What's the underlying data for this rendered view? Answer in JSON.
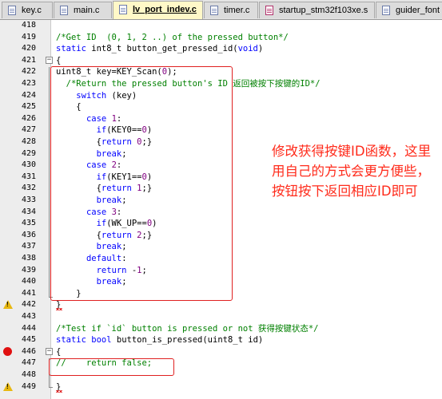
{
  "tabs": [
    {
      "label": "key.c",
      "active": false
    },
    {
      "label": "main.c",
      "active": false
    },
    {
      "label": "lv_port_indev.c",
      "active": true
    },
    {
      "label": "timer.c",
      "active": false
    },
    {
      "label": "startup_stm32f103xe.s",
      "active": false
    },
    {
      "label": "guider_font",
      "active": false
    }
  ],
  "editor": {
    "lines": [
      {
        "num": "418",
        "parts": [],
        "marker": ""
      },
      {
        "num": "419",
        "parts": [
          {
            "t": "/*Get ID  (0, 1, 2 ..) of the pressed button*/",
            "c": "cm"
          }
        ],
        "marker": ""
      },
      {
        "num": "420",
        "parts": [
          {
            "t": "static ",
            "c": "kw"
          },
          {
            "t": "int8_t button_get_pressed_id(",
            "c": ""
          },
          {
            "t": "void",
            "c": "kw"
          },
          {
            "t": ")",
            "c": ""
          }
        ],
        "marker": ""
      },
      {
        "num": "421",
        "parts": [
          {
            "t": "{",
            "c": ""
          }
        ],
        "marker": ""
      },
      {
        "num": "422",
        "parts": [
          {
            "t": "uint8_t key=KEY_Scan(",
            "c": ""
          },
          {
            "t": "0",
            "c": "num"
          },
          {
            "t": ");",
            "c": ""
          }
        ],
        "marker": ""
      },
      {
        "num": "423",
        "parts": [
          {
            "t": "  /*Return the pressed button's ID 返回被按下按键的ID*/",
            "c": "cm"
          }
        ],
        "marker": ""
      },
      {
        "num": "424",
        "parts": [
          {
            "t": "    ",
            "c": ""
          },
          {
            "t": "switch",
            "c": "kw"
          },
          {
            "t": " (key)",
            "c": ""
          }
        ],
        "marker": ""
      },
      {
        "num": "425",
        "parts": [
          {
            "t": "    {",
            "c": ""
          }
        ],
        "marker": ""
      },
      {
        "num": "426",
        "parts": [
          {
            "t": "      ",
            "c": ""
          },
          {
            "t": "case",
            "c": "kw"
          },
          {
            "t": " ",
            "c": ""
          },
          {
            "t": "1",
            "c": "num"
          },
          {
            "t": ":",
            "c": ""
          }
        ],
        "marker": ""
      },
      {
        "num": "427",
        "parts": [
          {
            "t": "        ",
            "c": ""
          },
          {
            "t": "if",
            "c": "kw"
          },
          {
            "t": "(KEY0==",
            "c": ""
          },
          {
            "t": "0",
            "c": "num"
          },
          {
            "t": ")",
            "c": ""
          }
        ],
        "marker": ""
      },
      {
        "num": "428",
        "parts": [
          {
            "t": "        {",
            "c": ""
          },
          {
            "t": "return",
            "c": "kw"
          },
          {
            "t": " ",
            "c": ""
          },
          {
            "t": "0",
            "c": "num"
          },
          {
            "t": ";}",
            "c": ""
          }
        ],
        "marker": ""
      },
      {
        "num": "429",
        "parts": [
          {
            "t": "        ",
            "c": ""
          },
          {
            "t": "break",
            "c": "kw"
          },
          {
            "t": ";",
            "c": ""
          }
        ],
        "marker": ""
      },
      {
        "num": "430",
        "parts": [
          {
            "t": "      ",
            "c": ""
          },
          {
            "t": "case",
            "c": "kw"
          },
          {
            "t": " ",
            "c": ""
          },
          {
            "t": "2",
            "c": "num"
          },
          {
            "t": ":",
            "c": ""
          }
        ],
        "marker": ""
      },
      {
        "num": "431",
        "parts": [
          {
            "t": "        ",
            "c": ""
          },
          {
            "t": "if",
            "c": "kw"
          },
          {
            "t": "(KEY1==",
            "c": ""
          },
          {
            "t": "0",
            "c": "num"
          },
          {
            "t": ")",
            "c": ""
          }
        ],
        "marker": ""
      },
      {
        "num": "432",
        "parts": [
          {
            "t": "        {",
            "c": ""
          },
          {
            "t": "return",
            "c": "kw"
          },
          {
            "t": " ",
            "c": ""
          },
          {
            "t": "1",
            "c": "num"
          },
          {
            "t": ";}",
            "c": ""
          }
        ],
        "marker": ""
      },
      {
        "num": "433",
        "parts": [
          {
            "t": "        ",
            "c": ""
          },
          {
            "t": "break",
            "c": "kw"
          },
          {
            "t": ";",
            "c": ""
          }
        ],
        "marker": ""
      },
      {
        "num": "434",
        "parts": [
          {
            "t": "      ",
            "c": ""
          },
          {
            "t": "case",
            "c": "kw"
          },
          {
            "t": " ",
            "c": ""
          },
          {
            "t": "3",
            "c": "num"
          },
          {
            "t": ":",
            "c": ""
          }
        ],
        "marker": ""
      },
      {
        "num": "435",
        "parts": [
          {
            "t": "        ",
            "c": ""
          },
          {
            "t": "if",
            "c": "kw"
          },
          {
            "t": "(WK_UP==",
            "c": ""
          },
          {
            "t": "0",
            "c": "num"
          },
          {
            "t": ")",
            "c": ""
          }
        ],
        "marker": ""
      },
      {
        "num": "436",
        "parts": [
          {
            "t": "        {",
            "c": ""
          },
          {
            "t": "return",
            "c": "kw"
          },
          {
            "t": " ",
            "c": ""
          },
          {
            "t": "2",
            "c": "num"
          },
          {
            "t": ";}",
            "c": ""
          }
        ],
        "marker": ""
      },
      {
        "num": "437",
        "parts": [
          {
            "t": "        ",
            "c": ""
          },
          {
            "t": "break",
            "c": "kw"
          },
          {
            "t": ";",
            "c": ""
          }
        ],
        "marker": ""
      },
      {
        "num": "438",
        "parts": [
          {
            "t": "      ",
            "c": ""
          },
          {
            "t": "default",
            "c": "kw"
          },
          {
            "t": ":",
            "c": ""
          }
        ],
        "marker": ""
      },
      {
        "num": "439",
        "parts": [
          {
            "t": "        ",
            "c": ""
          },
          {
            "t": "return",
            "c": "kw"
          },
          {
            "t": " -",
            "c": ""
          },
          {
            "t": "1",
            "c": "num"
          },
          {
            "t": ";",
            "c": ""
          }
        ],
        "marker": ""
      },
      {
        "num": "440",
        "parts": [
          {
            "t": "        ",
            "c": ""
          },
          {
            "t": "break",
            "c": "kw"
          },
          {
            "t": ";",
            "c": ""
          }
        ],
        "marker": ""
      },
      {
        "num": "441",
        "parts": [
          {
            "t": "    }",
            "c": ""
          }
        ],
        "marker": ""
      },
      {
        "num": "442",
        "parts": [
          {
            "t": "}",
            "c": ""
          }
        ],
        "marker": "warning"
      },
      {
        "num": "443",
        "parts": [],
        "marker": ""
      },
      {
        "num": "444",
        "parts": [
          {
            "t": "/*Test if `id` button is pressed or not 获得按键状态*/",
            "c": "cm"
          }
        ],
        "marker": ""
      },
      {
        "num": "445",
        "parts": [
          {
            "t": "static ",
            "c": "kw"
          },
          {
            "t": "bool",
            "c": "kw"
          },
          {
            "t": " button_is_pressed(uint8_t id)",
            "c": ""
          }
        ],
        "marker": ""
      },
      {
        "num": "446",
        "parts": [
          {
            "t": "{",
            "c": ""
          }
        ],
        "marker": "breakpoint"
      },
      {
        "num": "447",
        "parts": [
          {
            "t": "//    return false;",
            "c": "cm"
          }
        ],
        "marker": ""
      },
      {
        "num": "448",
        "parts": [],
        "marker": ""
      },
      {
        "num": "449",
        "parts": [
          {
            "t": "}",
            "c": ""
          }
        ],
        "marker": "warning"
      }
    ]
  },
  "annotation": {
    "text": "修改获得按键ID函数，这里用自己的方式会更方便些，按钮按下返回相应ID即可",
    "color": "#ff2a1a"
  },
  "colors": {
    "keyword": "#0000ff",
    "comment": "#008000",
    "number": "#800080",
    "highlight_box": "#e02020",
    "active_tab": "#fff8c8"
  }
}
